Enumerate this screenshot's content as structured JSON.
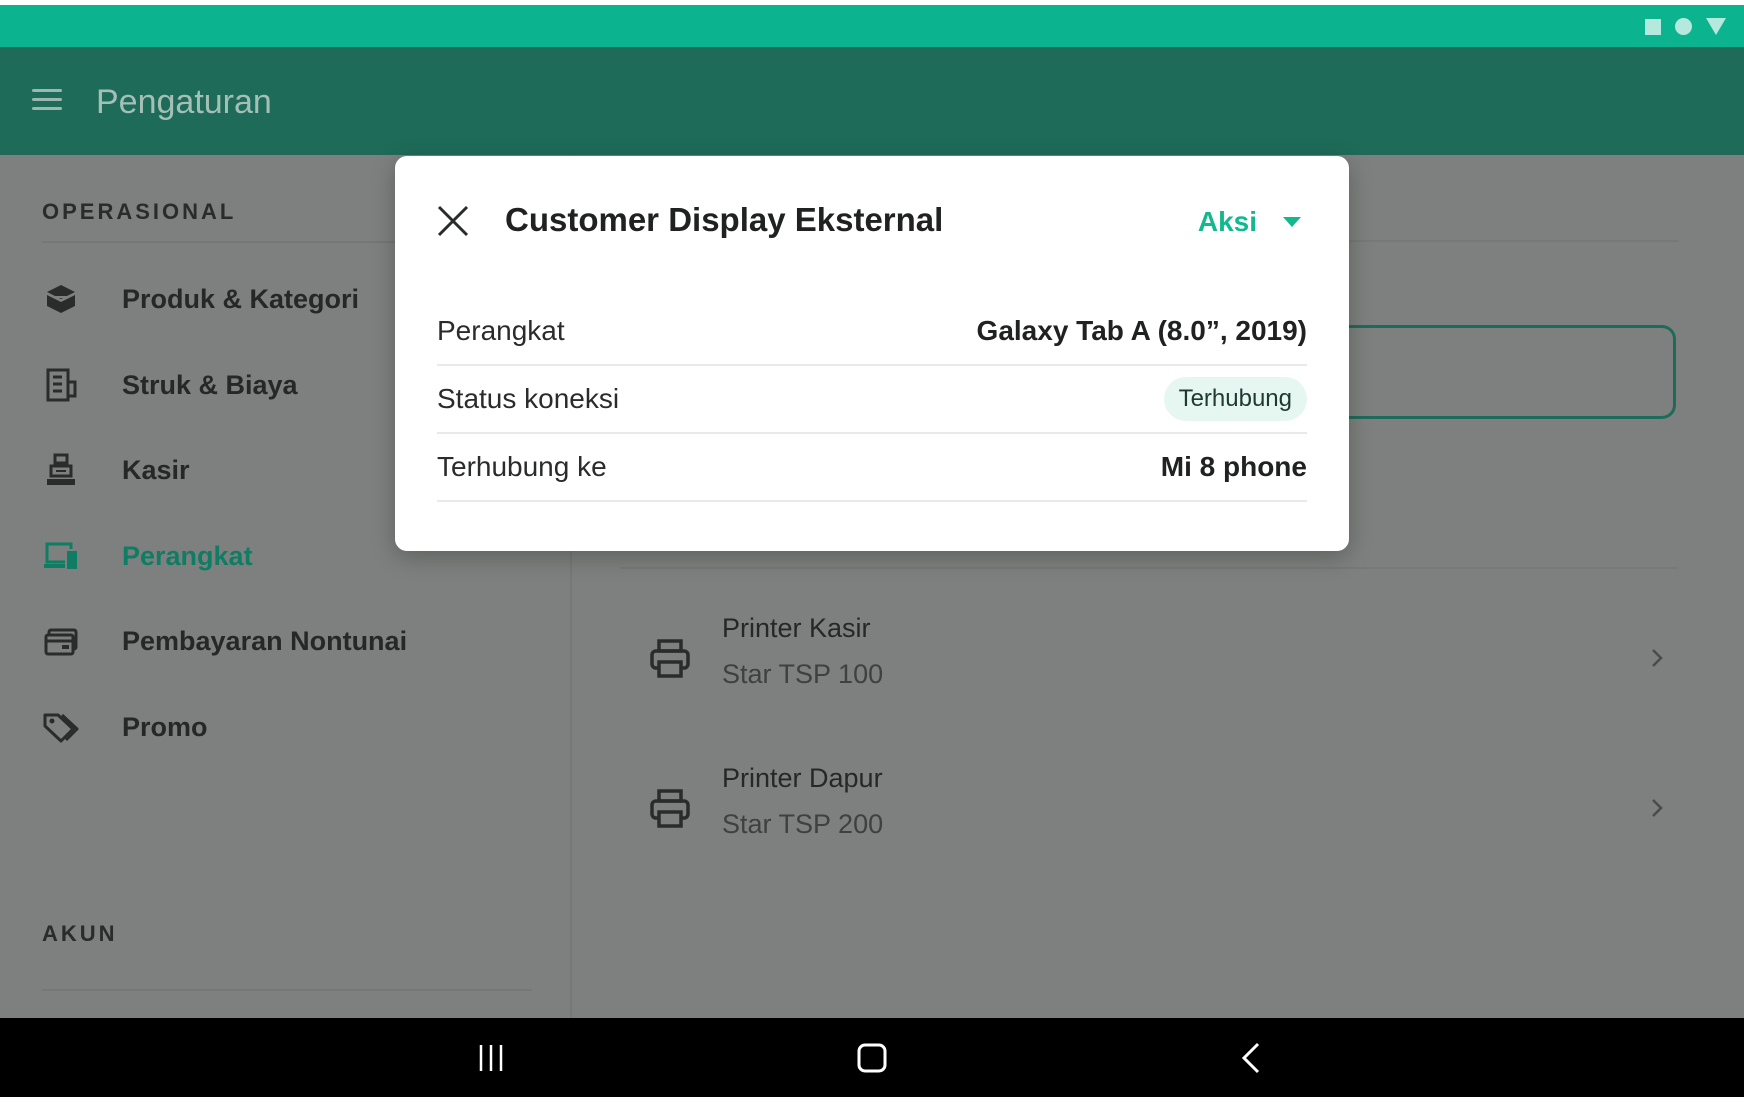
{
  "app_bar": {
    "title": "Pengaturan"
  },
  "sidebar": {
    "section_operasional": "OPERASIONAL",
    "section_akun": "AKUN",
    "items": [
      {
        "label": "Produk & Kategori",
        "icon": "box-icon"
      },
      {
        "label": "Struk & Biaya",
        "icon": "receipt-icon"
      },
      {
        "label": "Kasir",
        "icon": "cashier-icon"
      },
      {
        "label": "Perangkat",
        "icon": "devices-icon",
        "active": true
      },
      {
        "label": "Pembayaran Nontunai",
        "icon": "wallet-icon"
      },
      {
        "label": "Promo",
        "icon": "tag-icon"
      }
    ]
  },
  "devices": [
    {
      "title": "Printer Kasir",
      "subtitle": "Star TSP 100"
    },
    {
      "title": "Printer Dapur",
      "subtitle": "Star TSP 200"
    }
  ],
  "modal": {
    "title": "Customer Display Eksternal",
    "action_label": "Aksi",
    "rows": [
      {
        "key": "Perangkat",
        "value": "Galaxy Tab A (8.0”, 2019)"
      },
      {
        "key": "Status koneksi",
        "value": "Terhubung"
      },
      {
        "key": "Terhubung ke",
        "value": "Mi 8 phone"
      }
    ]
  },
  "colors": {
    "status_bar": "#0bb48f",
    "app_bar": "#1e6b5a",
    "accent": "#12b98f",
    "scrim": "#7e807f"
  }
}
